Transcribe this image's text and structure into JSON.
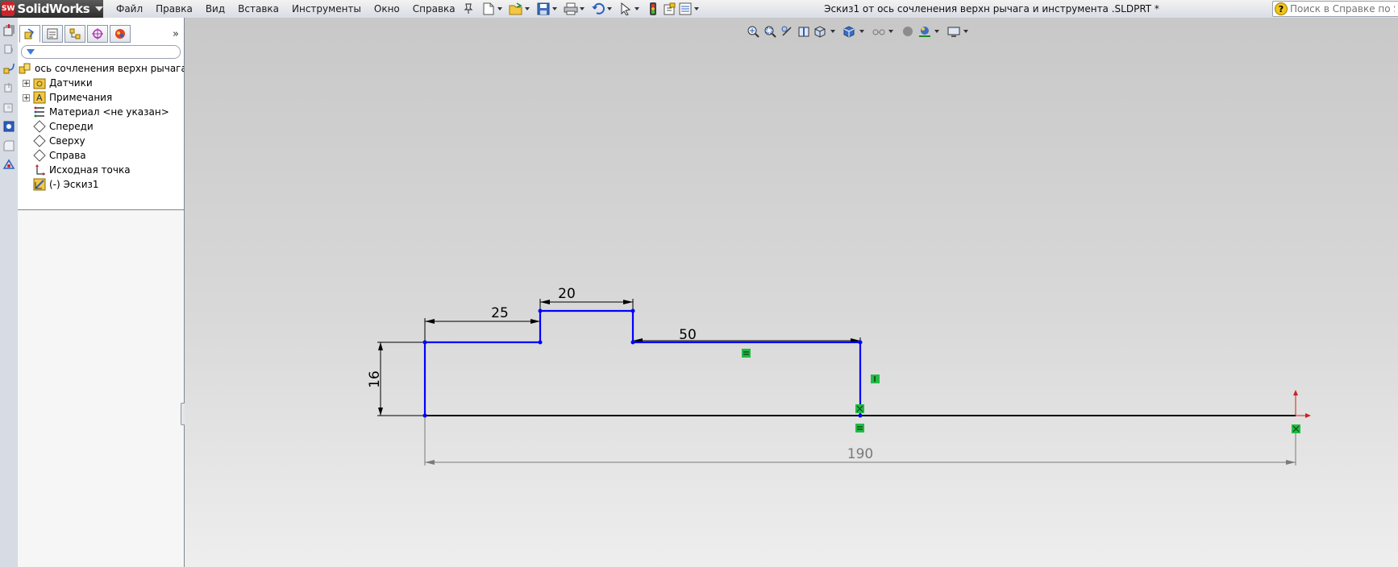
{
  "app": {
    "name": "SolidWorks",
    "logo_badge": "SW"
  },
  "menu": [
    "Файл",
    "Правка",
    "Вид",
    "Вставка",
    "Инструменты",
    "Окно",
    "Справка"
  ],
  "toolbar_icons": [
    "new-icon",
    "open-icon",
    "save-icon",
    "print-icon",
    "undo-icon",
    "select-icon",
    "rebuild-icon",
    "options-icon",
    "settings-icon"
  ],
  "document_title": "Эскиз1 от ось  сочленения верхн рычага и инструмента .SLDPRT *",
  "help_search": {
    "placeholder": "Поиск в Справке по SolidWorks"
  },
  "feature_tree": {
    "tabs": [
      "featuremanager-tab",
      "propertymanager-tab",
      "configurationmanager-tab",
      "dimxpert-tab",
      "display-manager-tab"
    ],
    "root": "ось  сочленения верхн рычага и инструмента",
    "items": [
      {
        "label": "Датчики",
        "icon": "sensor-folder-icon",
        "expandable": true
      },
      {
        "label": "Примечания",
        "icon": "annotations-icon",
        "expandable": true
      },
      {
        "label": "Материал <не указан>",
        "icon": "material-icon",
        "expandable": false
      },
      {
        "label": "Спереди",
        "icon": "plane-icon",
        "expandable": false
      },
      {
        "label": "Сверху",
        "icon": "plane-icon",
        "expandable": false
      },
      {
        "label": "Справа",
        "icon": "plane-icon",
        "expandable": false
      },
      {
        "label": "Исходная точка",
        "icon": "origin-icon",
        "expandable": false
      },
      {
        "label": "(-) Эскиз1",
        "icon": "sketch-icon",
        "expandable": false
      }
    ]
  },
  "sketch": {
    "dimensions": {
      "step_left": "25",
      "step_top": "20",
      "step_right": "50",
      "height": "16",
      "total_length": "190"
    },
    "colors": {
      "sketch_line": "#0000ff",
      "dimension": "#000000",
      "driven_dimension": "#7a7a7a",
      "relation_badge": "#22bb44",
      "origin": "#d02020"
    }
  }
}
